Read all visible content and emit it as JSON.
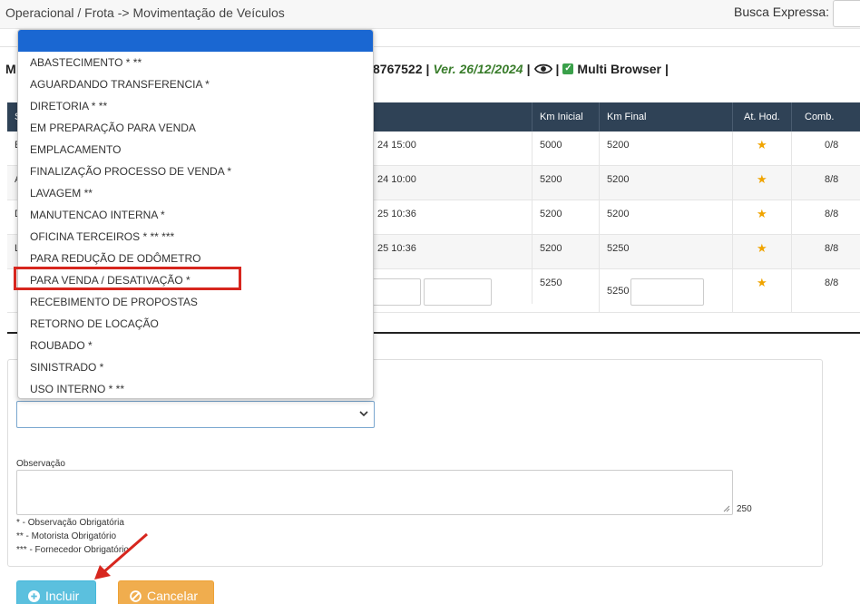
{
  "header": {
    "breadcrumb": "Operacional / Frota -> Movimentação de Veículos",
    "search_label": "Busca Expressa:"
  },
  "infoline": {
    "prefix": "M",
    "id": "8767522",
    "sep1": "|",
    "version": "Ver. 26/12/2024",
    "sep2": "|",
    "sep3": "|",
    "multi_browser": "Multi Browser",
    "sep4": "|"
  },
  "table": {
    "headers": [
      "S",
      "Km Inicial",
      "Km Final",
      "At. Hod.",
      "Comb. Saída"
    ],
    "rows": [
      {
        "lead": "E",
        "date": "24 15:00",
        "km_inicial": "5000",
        "km_final": "5200",
        "comb": "0/8"
      },
      {
        "lead": "A",
        "date": "24 10:00",
        "km_inicial": "5200",
        "km_final": "5200",
        "comb": "8/8"
      },
      {
        "lead": "D",
        "date": "25 10:36",
        "km_inicial": "5200",
        "km_final": "5200",
        "comb": "8/8"
      },
      {
        "lead": "L",
        "date": "25 10:36",
        "km_inicial": "5200",
        "km_final": "5250",
        "comb": "8/8"
      },
      {
        "lead": "",
        "date": "",
        "km_inicial": "5250",
        "km_final": "5250",
        "comb": "8/8"
      }
    ]
  },
  "dropdown": {
    "options": [
      "ABASTECIMENTO * **",
      "AGUARDANDO TRANSFERENCIA *",
      "DIRETORIA * **",
      "EM PREPARAÇÃO PARA VENDA",
      "EMPLACAMENTO",
      "FINALIZAÇÃO PROCESSO DE VENDA *",
      "LAVAGEM **",
      "MANUTENCAO INTERNA *",
      "OFICINA TERCEIROS * ** ***",
      "PARA REDUÇÃO DE ODÔMETRO",
      "PARA VENDA / DESATIVAÇÃO *",
      "RECEBIMENTO DE PROPOSTAS",
      "RETORNO DE LOCAÇÃO",
      "ROUBADO *",
      "SINISTRADO *",
      "USO INTERNO * **"
    ],
    "highlighted": "PARA VENDA / DESATIVAÇÃO *"
  },
  "form": {
    "obs_label": "Observação",
    "counter": "250",
    "legend": [
      "*   - Observação Obrigatória",
      "** - Motorista Obrigatório",
      "*** - Fornecedor Obrigatório"
    ]
  },
  "buttons": {
    "incluir": "Incluir",
    "cancelar": "Cancelar"
  },
  "colors": {
    "table_header": "#2f4256",
    "dropdown_selected": "#1a67d2",
    "highlight": "#d7261e",
    "btn_incluir": "#5bc0de",
    "btn_cancelar": "#f0ad4e",
    "version_text": "#3a7d2c"
  }
}
